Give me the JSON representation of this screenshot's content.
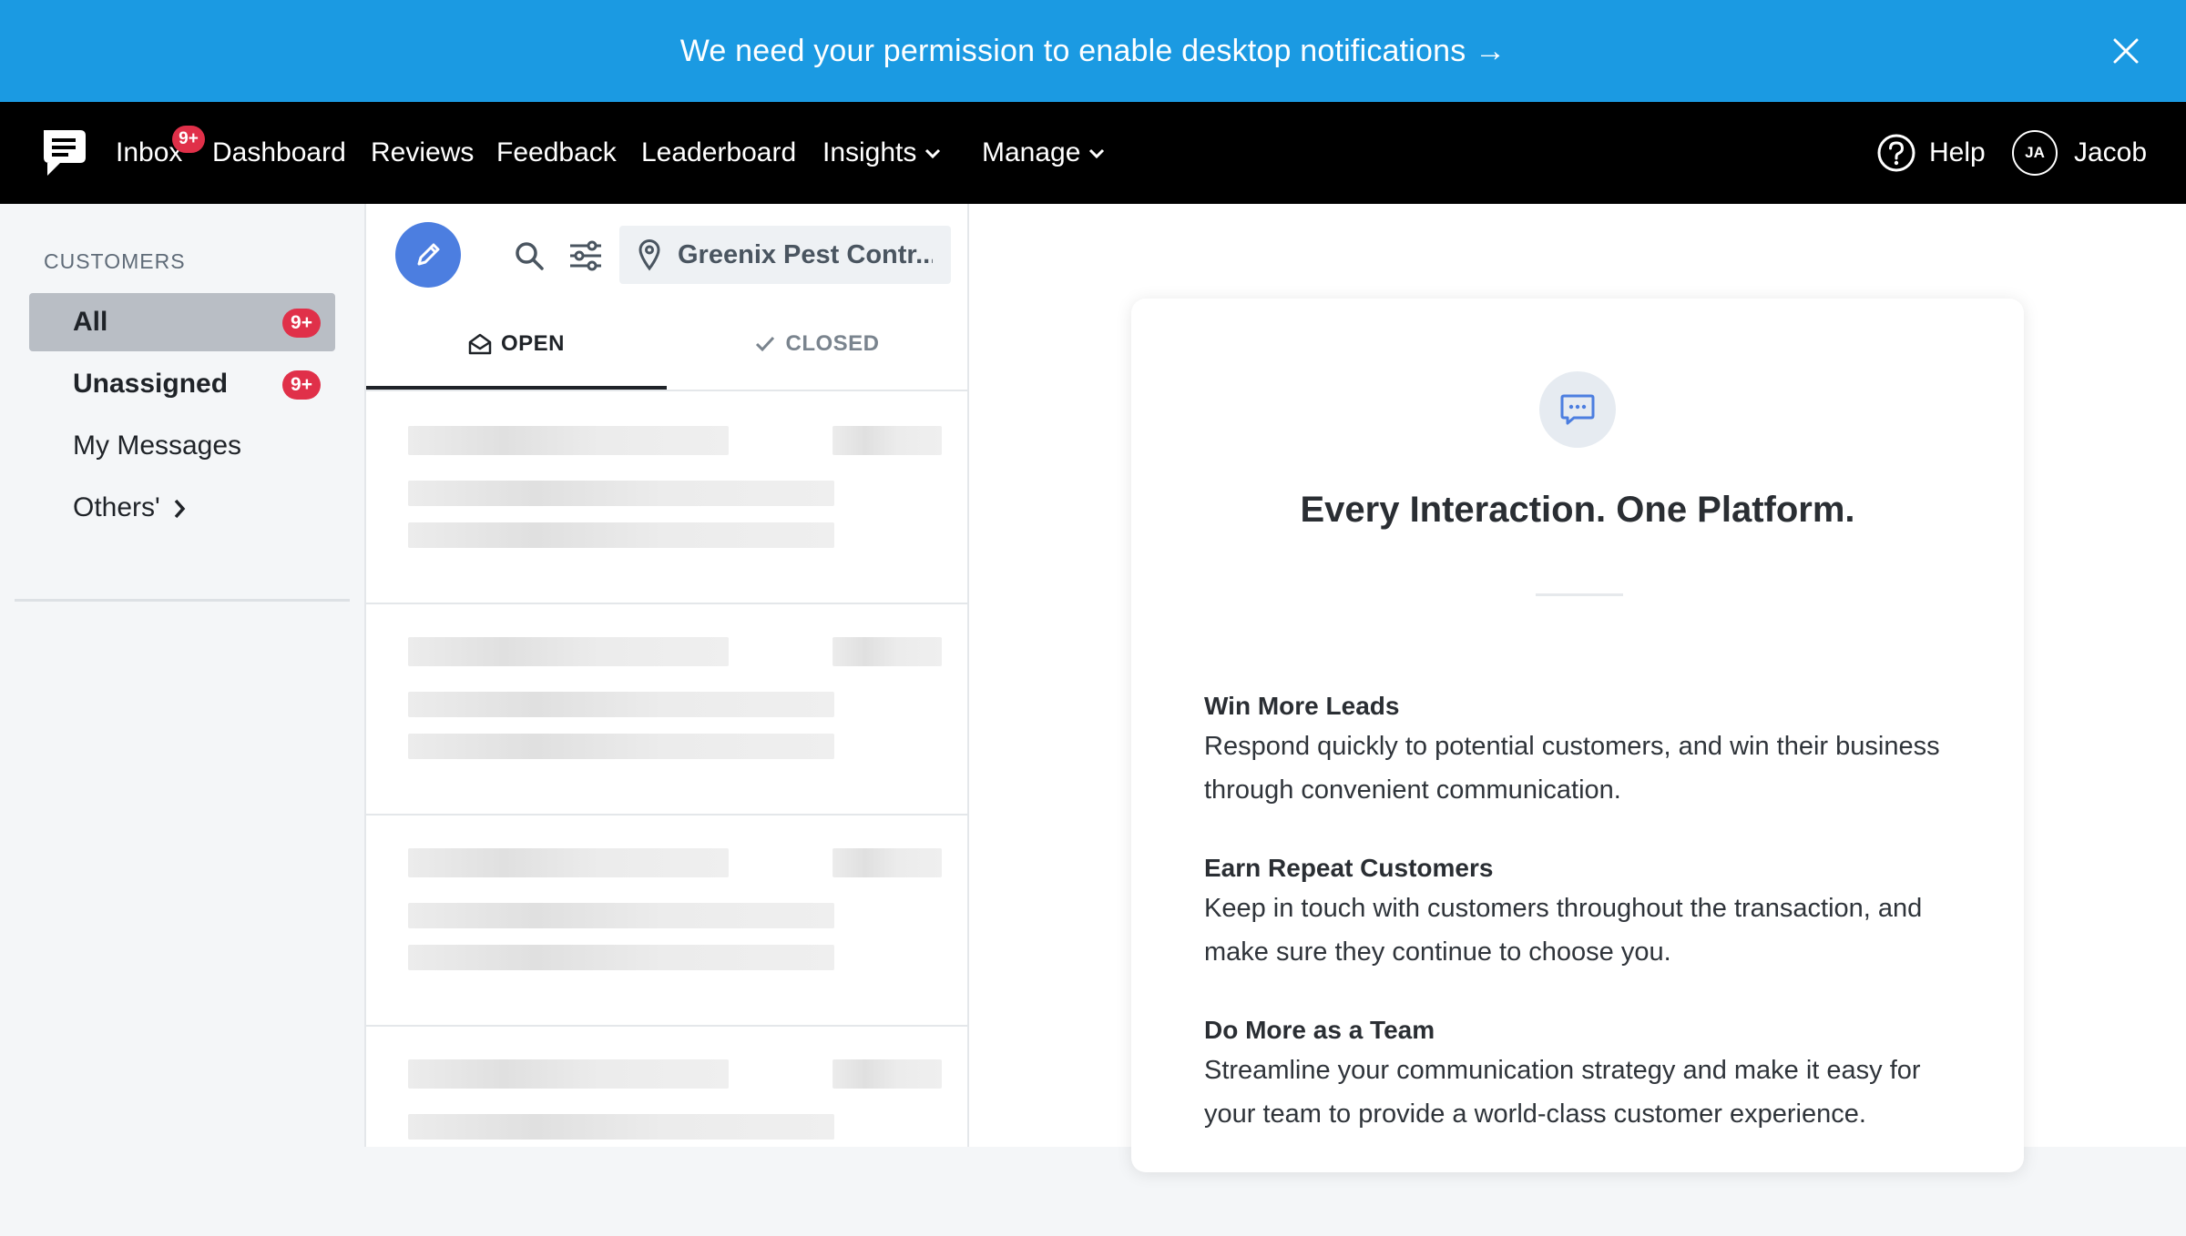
{
  "banner": {
    "text": "We need your permission to enable desktop notifications →",
    "close_icon": "close-icon"
  },
  "nav": {
    "logo_icon": "chat-bubble-logo-icon",
    "items": [
      "Inbox",
      "Dashboard",
      "Reviews",
      "Feedback",
      "Leaderboard",
      "Insights",
      "Manage"
    ],
    "inbox_badge": "9+",
    "help_label": "Help",
    "user_initials": "JA",
    "user_name": "Jacob"
  },
  "sidebar": {
    "heading": "CUSTOMERS",
    "items": [
      {
        "label": "All",
        "badge": "9+",
        "active": true
      },
      {
        "label": "Unassigned",
        "badge": "9+",
        "active": false
      },
      {
        "label": "My Messages",
        "badge": "",
        "active": false
      },
      {
        "label": "Others'",
        "badge": "",
        "active": false
      }
    ]
  },
  "list": {
    "location": "Greenix Pest Contr...",
    "tabs": [
      "OPEN",
      "CLOSED"
    ],
    "active_tab": "OPEN",
    "skeleton_rows": 4
  },
  "panel": {
    "title": "Every Interaction. One Platform.",
    "features": [
      {
        "title": "Win More Leads",
        "body": "Respond quickly to potential customers, and win their business through convenient communication."
      },
      {
        "title": "Earn Repeat Customers",
        "body": "Keep in touch with customers throughout the transaction, and make sure they continue to choose you."
      },
      {
        "title": "Do More as a Team",
        "body": "Streamline your communication strategy and make it easy for your team to provide a world-class customer experience."
      }
    ]
  },
  "colors": {
    "banner": "#1b9ae2",
    "nav": "#000000",
    "badge": "#e03049",
    "compose": "#4c7ee0",
    "active_item": "#b9bec5"
  }
}
